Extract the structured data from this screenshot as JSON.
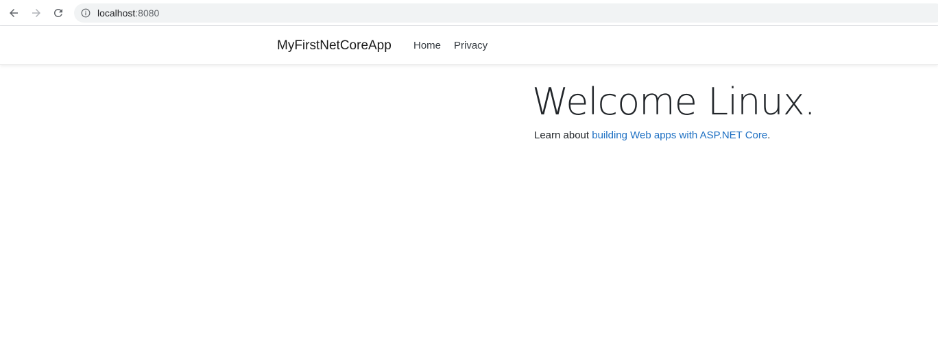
{
  "browser": {
    "url_host": "localhost",
    "url_port": ":8080",
    "icons": {
      "back": "arrow-left-icon",
      "forward": "arrow-right-icon",
      "reload": "reload-icon",
      "info": "info-icon"
    }
  },
  "navbar": {
    "brand": "MyFirstNetCoreApp",
    "links": [
      {
        "label": "Home"
      },
      {
        "label": "Privacy"
      }
    ]
  },
  "main": {
    "title": "Welcome Linux.",
    "learn_prefix": "Learn about ",
    "learn_link": "building Web apps with ASP.NET Core",
    "learn_suffix": "."
  },
  "colors": {
    "link": "#1b6ec2",
    "text": "#212529",
    "omnibox_bg": "#f1f3f4"
  }
}
